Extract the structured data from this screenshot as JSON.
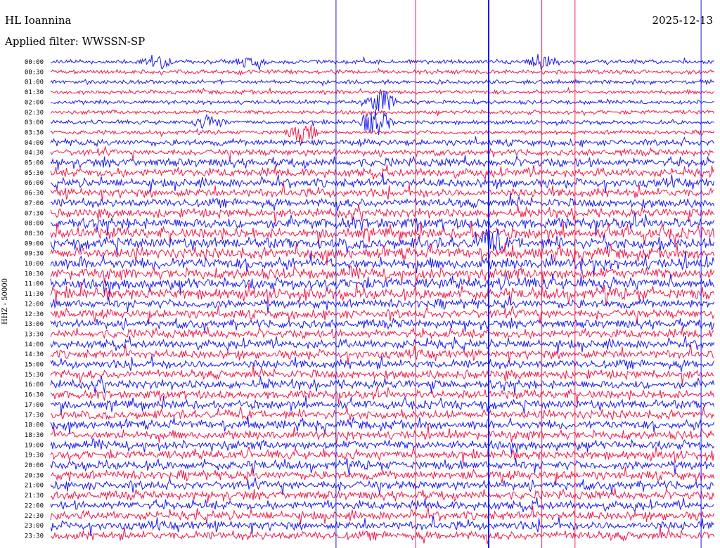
{
  "header": {
    "station": "HL Ioannina",
    "date": "2025-12-13",
    "filter": "Applied filter: WWSSN-SP"
  },
  "side_label": "HHZ - 50000",
  "colors": {
    "blue": "#1a1aee",
    "red": "#ee1a4a",
    "background": "#ffffff"
  },
  "chart_data": {
    "type": "line",
    "title": "",
    "xlabel": "",
    "ylabel": "HHZ - 50000",
    "row_labels": [
      "00:00",
      "00:30",
      "01:00",
      "01:30",
      "02:00",
      "02:30",
      "03:00",
      "03:30",
      "04:00",
      "04:30",
      "05:00",
      "05:30",
      "06:00",
      "06:30",
      "07:00",
      "07:30",
      "08:00",
      "08:30",
      "09:00",
      "09:30",
      "10:00",
      "10:30",
      "11:00",
      "11:30",
      "12:00",
      "12:30",
      "13:00",
      "13:30",
      "14:00",
      "14:30",
      "15:00",
      "15:30",
      "16:00",
      "16:30",
      "17:00",
      "17:30",
      "18:00",
      "18:30",
      "19:00",
      "19:30",
      "20:00",
      "20:30",
      "21:00",
      "21:30",
      "22:00",
      "22:30",
      "23:00",
      "23:30"
    ],
    "row_colors": [
      "blue",
      "red"
    ],
    "row_noise_level": [
      1,
      1,
      1,
      1,
      1,
      1,
      1,
      1,
      2,
      2,
      3,
      3,
      3,
      3,
      3,
      3,
      4,
      4,
      4,
      4,
      4,
      4,
      4,
      4,
      3,
      3,
      3,
      3,
      3,
      3,
      3,
      3,
      3,
      3,
      3,
      3,
      3,
      3,
      3,
      3,
      3,
      3,
      3,
      3,
      3,
      3,
      3,
      3
    ],
    "events": [
      {
        "row": 0,
        "x": 0.16,
        "amp": 1.5
      },
      {
        "row": 0,
        "x": 0.3,
        "amp": 1.3
      },
      {
        "row": 0,
        "x": 0.74,
        "amp": 1.6
      },
      {
        "row": 4,
        "x": 0.5,
        "amp": 2.5
      },
      {
        "row": 6,
        "x": 0.24,
        "amp": 1.5
      },
      {
        "row": 6,
        "x": 0.49,
        "amp": 2.8
      },
      {
        "row": 7,
        "x": 0.38,
        "amp": 2.0
      },
      {
        "row": 18,
        "x": 0.66,
        "amp": 2.0
      }
    ],
    "spikes": [
      {
        "x": 0.66,
        "color": "blue"
      },
      {
        "x": 0.55,
        "color": "red"
      },
      {
        "x": 0.74,
        "color": "red"
      },
      {
        "x": 0.43,
        "color": "blue"
      },
      {
        "x": 0.79,
        "color": "red"
      },
      {
        "x": 0.98,
        "color": "blue"
      }
    ]
  }
}
